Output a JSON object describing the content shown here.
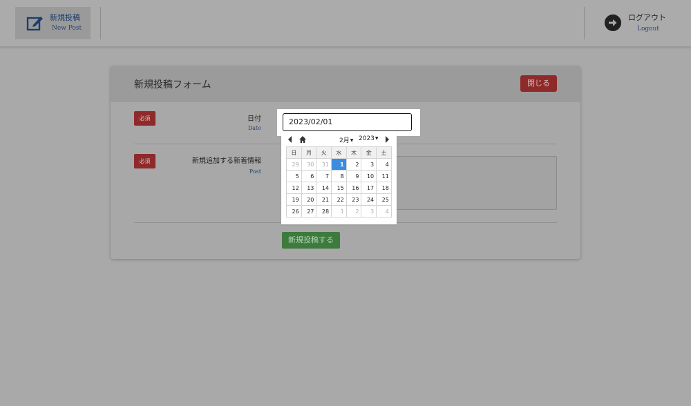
{
  "header": {
    "new_post": {
      "label": "新規投稿",
      "sublabel": "New Post",
      "icon": "edit-icon"
    },
    "logout": {
      "label": "ログアウト",
      "sublabel": "Logout",
      "icon": "arrow-right-circle-icon"
    }
  },
  "form": {
    "title": "新規投稿フォーム",
    "close_label": "閉じる",
    "required_badge": "必須",
    "date_field": {
      "label": "日付",
      "sublabel": "Date",
      "value": "2023/02/01"
    },
    "post_field": {
      "label": "新規追加する新着情報",
      "sublabel": "Post",
      "value": ""
    },
    "submit_label": "新規投稿する"
  },
  "datepicker": {
    "month": "2月",
    "year": "2023",
    "weekdays": [
      "日",
      "月",
      "火",
      "水",
      "木",
      "金",
      "土"
    ],
    "weeks": [
      [
        "29",
        "30",
        "31",
        "1",
        "2",
        "3",
        "4"
      ],
      [
        "5",
        "6",
        "7",
        "8",
        "9",
        "10",
        "11"
      ],
      [
        "12",
        "13",
        "14",
        "15",
        "16",
        "17",
        "18"
      ],
      [
        "19",
        "20",
        "21",
        "22",
        "23",
        "24",
        "25"
      ],
      [
        "26",
        "27",
        "28",
        "1",
        "2",
        "3",
        "4"
      ]
    ],
    "selected_day": "1"
  },
  "colors": {
    "overlay_bg": "#a9a9a9",
    "required": "#8e2a2a",
    "close_button": "#8f2a2a",
    "submit_button": "#3d7a3d",
    "selected_day": "#3a8de0"
  }
}
